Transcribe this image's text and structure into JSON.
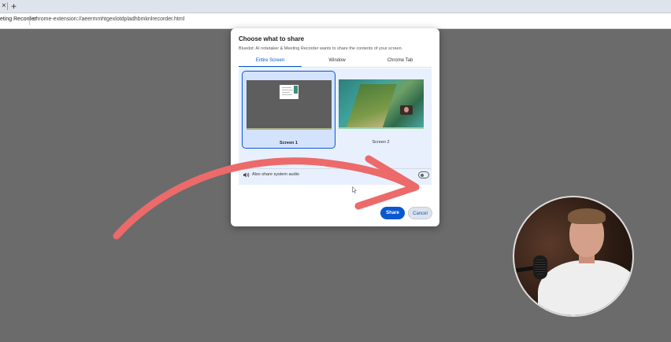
{
  "browser": {
    "tab_close_glyph": "×",
    "new_tab_glyph": "+",
    "page_title": "eting Recorder",
    "url": "chrome-extension://aeermmhtgexlotdpladhbmknlrecorder.html"
  },
  "dialog": {
    "title": "Choose what to share",
    "subtitle": "Bluedot: AI notetaker & Meeting Recorder wants to share the contents of your screen.",
    "tabs": [
      {
        "label": "Entire Screen",
        "active": true
      },
      {
        "label": "Window",
        "active": false
      },
      {
        "label": "Chrome Tab",
        "active": false
      }
    ],
    "screens": [
      {
        "label": "Screen 1",
        "selected": true
      },
      {
        "label": "Screen 2",
        "selected": false
      }
    ],
    "audio_label": "Also share system audio",
    "audio_enabled": false,
    "share_label": "Share",
    "cancel_label": "Cancel"
  },
  "icons": {
    "speaker": "speaker-icon",
    "cursor": "mouse-pointer-icon"
  },
  "colors": {
    "accent": "#0b57d0",
    "arrow": "#ec6a6a",
    "backdrop": "#6b6b6b"
  }
}
